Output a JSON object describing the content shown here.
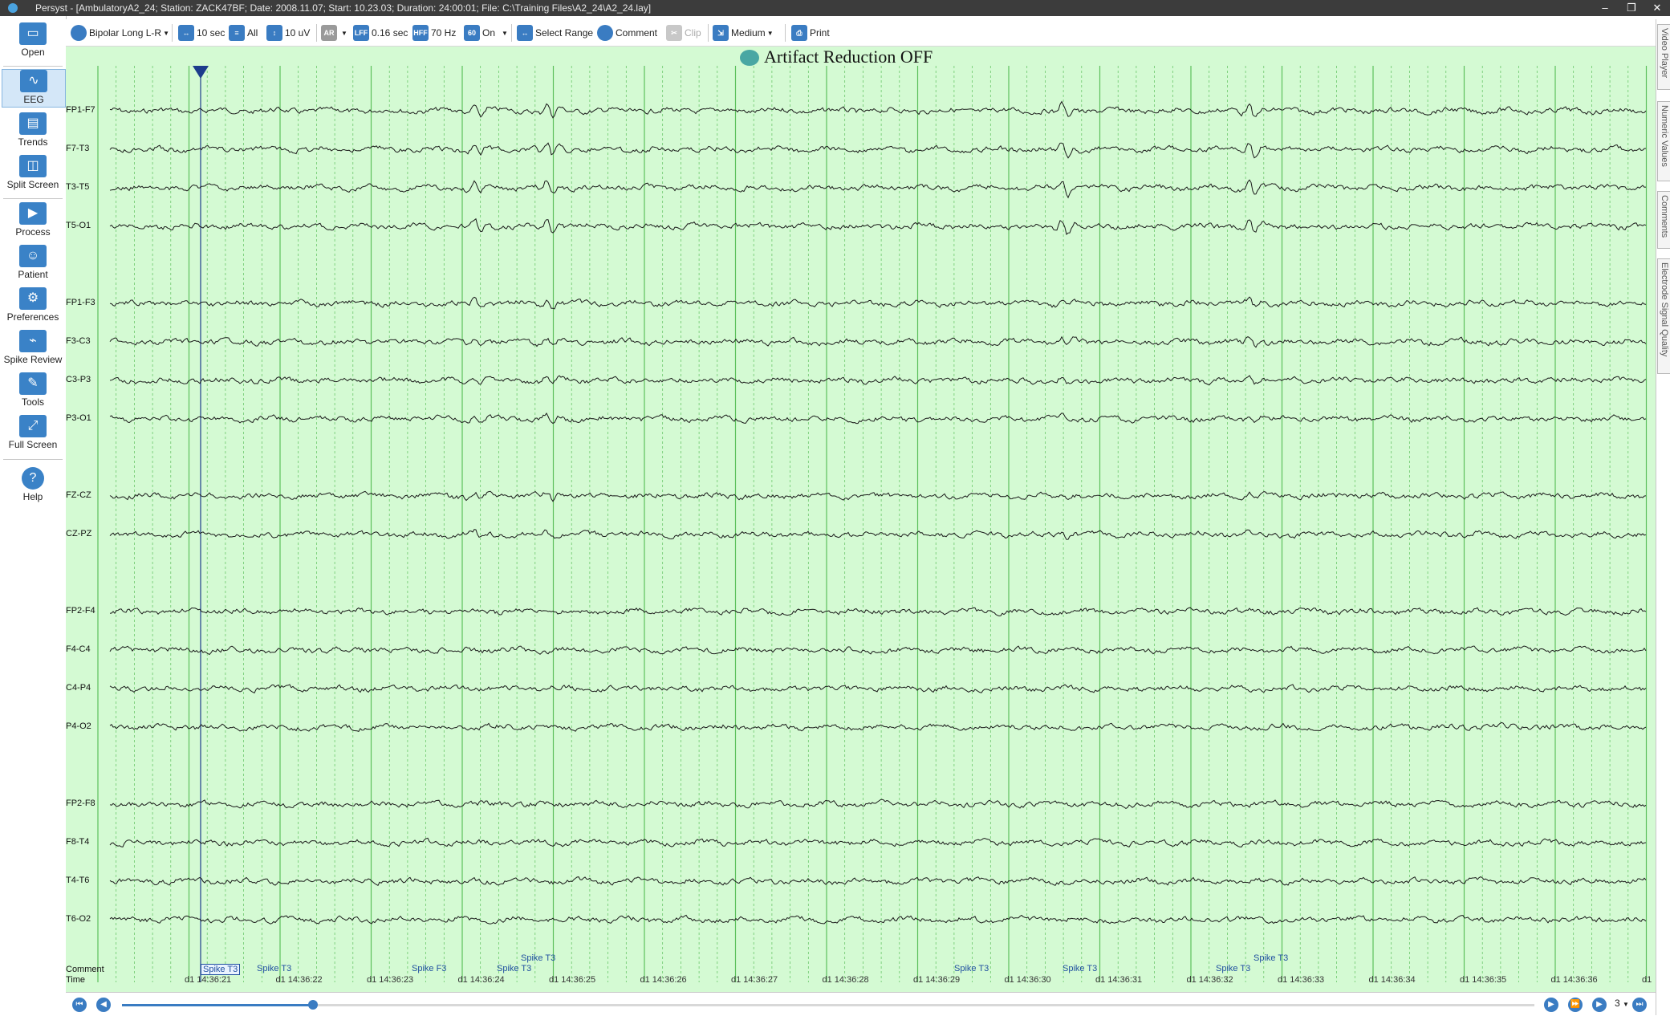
{
  "window": {
    "title": "Persyst - [AmbulatoryA2_24; Station: ZACK47BF; Date: 2008.11.07; Start: 10.23.03; Duration: 24:00:01; File: C:\\Training Files\\A2_24\\A2_24.lay]",
    "minimize": "–",
    "restore": "❐",
    "close": "✕"
  },
  "sidebar": {
    "items": [
      {
        "label": "Open",
        "icon": "folder-icon",
        "glyph": "▭"
      },
      {
        "label": "EEG",
        "icon": "eeg-icon",
        "glyph": "∿"
      },
      {
        "label": "Trends",
        "icon": "trends-icon",
        "glyph": "▤"
      },
      {
        "label": "Split Screen",
        "icon": "split-screen-icon",
        "glyph": "◫"
      },
      {
        "label": "Process",
        "icon": "play-icon",
        "glyph": "▶"
      },
      {
        "label": "Patient",
        "icon": "patient-icon",
        "glyph": "☺"
      },
      {
        "label": "Preferences",
        "icon": "gear-icon",
        "glyph": "⚙"
      },
      {
        "label": "Spike Review",
        "icon": "spike-review-icon",
        "glyph": "⌁"
      },
      {
        "label": "Tools",
        "icon": "tools-icon",
        "glyph": "✎"
      },
      {
        "label": "Full Screen",
        "icon": "fullscreen-icon",
        "glyph": "⤢"
      },
      {
        "label": "Help",
        "icon": "help-icon",
        "glyph": "?"
      }
    ]
  },
  "toolbar": {
    "montage": "Bipolar Long L-R",
    "timebase": "10 sec",
    "channels": "All",
    "sensitivity": "10 uV",
    "ar_badge": "AR",
    "lff_badge": "LFF",
    "lff": "0.16 sec",
    "hff_badge": "HFF",
    "hff": "70 Hz",
    "notch_badge": "60",
    "notch": "On",
    "select_range": "Select Range",
    "comment": "Comment",
    "clip": "Clip",
    "medium": "Medium",
    "print": "Print"
  },
  "right_tabs": [
    "Video Player",
    "Numeric Values",
    "Comments",
    "Electrode Signal Quality"
  ],
  "eeg": {
    "banner": "Artifact Reduction OFF",
    "colors": {
      "background": "#d4fad3",
      "trace": "#1a1a1a",
      "gridline": "#5cc05c",
      "cursor": "#1d3c8c"
    },
    "channels": [
      "FP1-F7",
      "F7-T3",
      "T3-T5",
      "T5-O1",
      "FP1-F3",
      "F3-C3",
      "C3-P3",
      "P3-O1",
      "FZ-CZ",
      "CZ-PZ",
      "FP2-F4",
      "F4-C4",
      "C4-P4",
      "P4-O2",
      "FP2-F8",
      "F8-T4",
      "T4-T6",
      "T6-O2"
    ],
    "comment_label": "Comment",
    "time_label": "Time",
    "comments": [
      {
        "text": "Spike T3",
        "boxed": true
      },
      {
        "text": "Spike T3"
      },
      {
        "text": "Spike F3"
      },
      {
        "text": "Spike T3"
      },
      {
        "text": "Spike T3"
      },
      {
        "text": "Spike T3"
      },
      {
        "text": "Spike T3"
      },
      {
        "text": "Spike T3"
      },
      {
        "text": "Spike T3"
      }
    ],
    "timestamps": [
      "d1 14:36:21",
      "d1 14:36:22",
      "d1 14:36:23",
      "d1 14:36:24",
      "d1 14:36:25",
      "d1 14:36:26",
      "d1 14:36:27",
      "d1 14:36:28",
      "d1 14:36:29",
      "d1 14:36:30",
      "d1 14:36:31",
      "d1 14:36:32",
      "d1 14:36:33",
      "d1 14:36:34",
      "d1 14:36:35",
      "d1 14:36:36",
      "d1"
    ]
  },
  "nav": {
    "speed": "3",
    "position_fraction": 0.135
  }
}
